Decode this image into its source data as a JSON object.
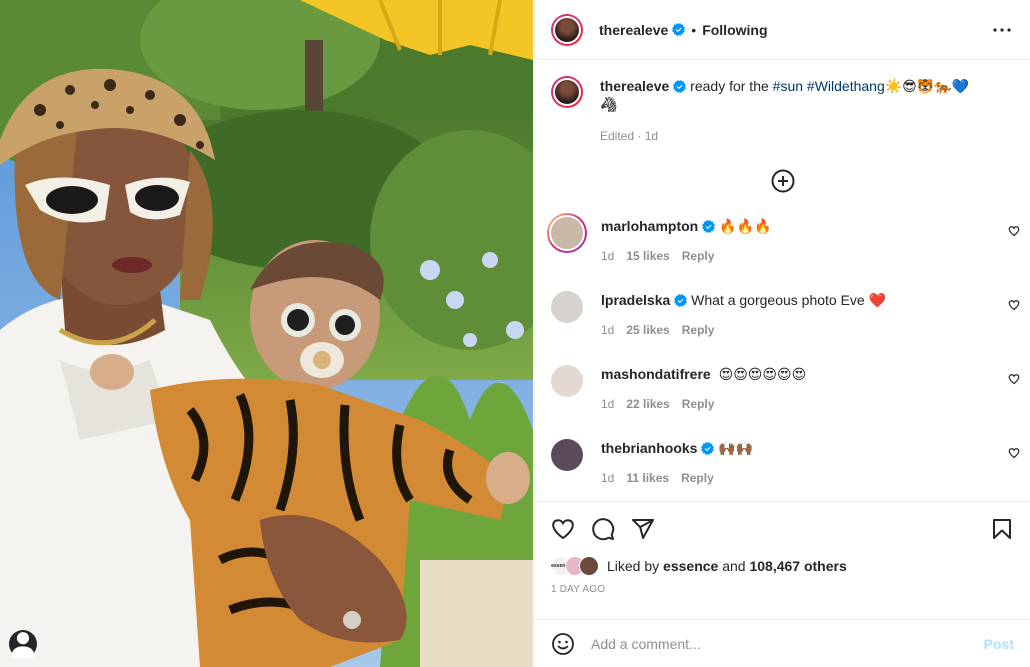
{
  "post": {
    "author": "therealeve",
    "follow_state": "Following",
    "separator": "•",
    "caption": {
      "lead": "ready for the",
      "hashtags": [
        "#sun",
        "#Wildethang"
      ],
      "emojis": "☀️😎🐯🐅💙",
      "emoji_line2": "🦓",
      "edited": "Edited · 1d"
    }
  },
  "comments": [
    {
      "username": "marlohampton",
      "verified": true,
      "text": "🔥🔥🔥",
      "age": "1d",
      "likes": "15 likes",
      "reply": "Reply",
      "avatar_color": "#c9b8a6"
    },
    {
      "username": "lpradelska",
      "verified": true,
      "text": "What a gorgeous photo Eve ❤️",
      "age": "1d",
      "likes": "25 likes",
      "reply": "Reply",
      "avatar_color": "#d8d2cf"
    },
    {
      "username": "mashondatifrere",
      "verified": false,
      "text": "😍😍😍😍😍😍",
      "age": "1d",
      "likes": "22 likes",
      "reply": "Reply",
      "avatar_color": "#e4d8d3"
    },
    {
      "username": "thebrianhooks",
      "verified": true,
      "text": "🙌🏾🙌🏾",
      "age": "1d",
      "likes": "11 likes",
      "reply": "Reply",
      "avatar_color": "#5b4a5c"
    }
  ],
  "likes": {
    "prefix": "Liked by",
    "liker": "essence",
    "and": "and",
    "others": "108,467 others",
    "mini_avatar_label": "essence"
  },
  "date": "1 DAY AGO",
  "comment_box": {
    "placeholder": "Add a comment...",
    "post_label": "Post"
  },
  "colors": {
    "verified": "#0095f6",
    "hashtag": "#00376b",
    "post_disabled": "#b2dffc",
    "story_ring": "#d62976"
  }
}
